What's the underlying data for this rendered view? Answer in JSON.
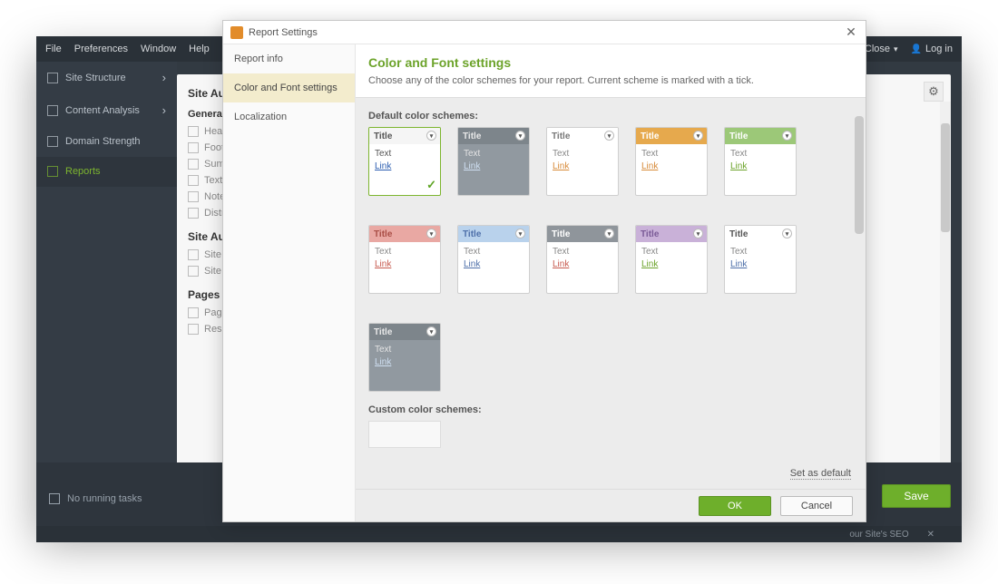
{
  "app": {
    "menubar": [
      "File",
      "Preferences",
      "Window",
      "Help"
    ],
    "topbar_right": {
      "close": "Close",
      "login": "Log in"
    },
    "sidebar": {
      "items": [
        {
          "label": "Site Structure",
          "expandable": true
        },
        {
          "label": "Content Analysis",
          "expandable": true
        },
        {
          "label": "Domain Strength",
          "expandable": false
        },
        {
          "label": "Reports",
          "expandable": false,
          "active": true
        }
      ]
    },
    "running_tasks": "No running tasks",
    "save_button": "Save",
    "seo_bar": "our Site's SEO",
    "checklist": {
      "section1_title": "Site Au",
      "group1_title": "Genera",
      "group1_items": [
        "Head",
        "Foote",
        "Sumn",
        "Text",
        "Note",
        "Distri"
      ],
      "section2_title": "Site Au",
      "section2_items": [
        "Site A",
        "Site A"
      ],
      "section3_title": "Pages &",
      "section3_items": [
        "Pages",
        "Reso"
      ]
    }
  },
  "modal": {
    "title": "Report Settings",
    "nav": [
      {
        "label": "Report info"
      },
      {
        "label": "Color and Font settings",
        "active": true
      },
      {
        "label": "Localization"
      }
    ],
    "heading": "Color and Font settings",
    "subheading": "Choose any of the color schemes for your report. Current scheme is marked with a tick.",
    "default_label": "Default color schemes:",
    "custom_label": "Custom color schemes:",
    "set_default": "Set as default",
    "footer": {
      "ok": "OK",
      "cancel": "Cancel"
    },
    "card_labels": {
      "title": "Title",
      "text": "Text",
      "link": "Link"
    },
    "schemes": [
      {
        "title_bg": "#f5f5f5",
        "title_color": "#555",
        "body_bg": "#ffffff",
        "text_color": "#555",
        "link_color": "#2a5db0",
        "selected": true
      },
      {
        "title_bg": "#7d858b",
        "title_color": "#e8e8e8",
        "body_bg": "#9199a0",
        "text_color": "#e4e4e4",
        "link_color": "#cfe0f2"
      },
      {
        "title_bg": "#ffffff",
        "title_color": "#777",
        "body_bg": "#ffffff",
        "text_color": "#888",
        "link_color": "#d78b3a"
      },
      {
        "title_bg": "#e6a94d",
        "title_color": "#fff",
        "body_bg": "#ffffff",
        "text_color": "#888",
        "link_color": "#d78b3a"
      },
      {
        "title_bg": "#9cc878",
        "title_color": "#fff",
        "body_bg": "#ffffff",
        "text_color": "#888",
        "link_color": "#6ca32a"
      },
      {
        "title_bg": "#e9a8a3",
        "title_color": "#a94d45",
        "body_bg": "#ffffff",
        "text_color": "#888",
        "link_color": "#c75a4f"
      },
      {
        "title_bg": "#b9d2ec",
        "title_color": "#4d6fa9",
        "body_bg": "#ffffff",
        "text_color": "#888",
        "link_color": "#4d6fa9"
      },
      {
        "title_bg": "#8f959b",
        "title_color": "#fff",
        "body_bg": "#ffffff",
        "text_color": "#888",
        "link_color": "#c75a4f"
      },
      {
        "title_bg": "#c9b1d8",
        "title_color": "#7a5a96",
        "body_bg": "#ffffff",
        "text_color": "#888",
        "link_color": "#6ca32a"
      },
      {
        "title_bg": "#ffffff",
        "title_color": "#555",
        "body_bg": "#ffffff",
        "text_color": "#888",
        "link_color": "#4d6fa9"
      },
      {
        "title_bg": "#7d858b",
        "title_color": "#e8e8e8",
        "body_bg": "#9199a0",
        "text_color": "#e4e4e4",
        "link_color": "#cfe0f2",
        "tall": true
      }
    ]
  }
}
